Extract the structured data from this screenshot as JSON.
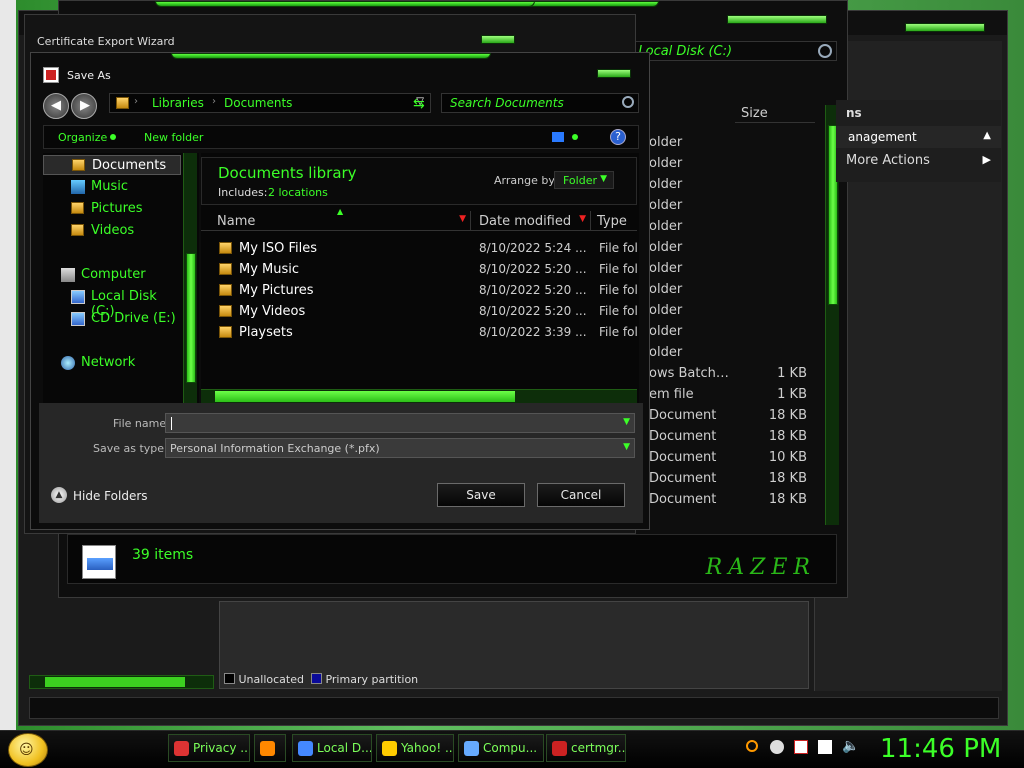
{
  "certmgr": {
    "title": "Certificate Export Wizard"
  },
  "explorer_bg": {
    "address": "h Local Disk (C:)",
    "col_size": "Size",
    "right_panel_title": "ns",
    "right_items": [
      "anagement",
      "More Actions"
    ],
    "rows": [
      {
        "type": "older",
        "size": ""
      },
      {
        "type": "older",
        "size": ""
      },
      {
        "type": "older",
        "size": ""
      },
      {
        "type": "older",
        "size": ""
      },
      {
        "type": "older",
        "size": ""
      },
      {
        "type": "older",
        "size": ""
      },
      {
        "type": "older",
        "size": ""
      },
      {
        "type": "older",
        "size": ""
      },
      {
        "type": "older",
        "size": ""
      },
      {
        "type": "older",
        "size": ""
      },
      {
        "type": "older",
        "size": ""
      },
      {
        "type": "ows Batch…",
        "size": "1 KB"
      },
      {
        "type": "em file",
        "size": "1 KB"
      },
      {
        "type": "Document",
        "size": "18 KB"
      },
      {
        "type": "Document",
        "size": "18 KB"
      },
      {
        "type": "Document",
        "size": "10 KB"
      },
      {
        "type": "Document",
        "size": "18 KB"
      },
      {
        "type": "Document",
        "size": "18 KB"
      }
    ],
    "status_count": "39 items",
    "logo_text": "RAZER"
  },
  "diskmgmt": {
    "legend": [
      "Unallocated",
      "Primary partition"
    ]
  },
  "dialog": {
    "title": "Save As",
    "breadcrumb": [
      "Libraries",
      "Documents"
    ],
    "search_placeholder": "Search Documents",
    "toolbar": {
      "organize": "Organize",
      "new_folder": "New folder"
    },
    "nav": {
      "favorites": [
        {
          "label": "Documents",
          "selected": true
        },
        {
          "label": "Music"
        },
        {
          "label": "Pictures"
        },
        {
          "label": "Videos"
        }
      ],
      "computer": "Computer",
      "drives": [
        "Local Disk (C:)",
        "CD Drive (E:)"
      ],
      "network": "Network"
    },
    "library": {
      "title": "Documents library",
      "includes_label": "Includes:",
      "includes_value": "2 locations",
      "arrange_label": "Arrange by:",
      "arrange_value": "Folder"
    },
    "columns": [
      "Name",
      "Date modified",
      "Type"
    ],
    "files": [
      {
        "name": "My ISO Files",
        "date": "8/10/2022 5:24 ...",
        "type": "File folc"
      },
      {
        "name": "My Music",
        "date": "8/10/2022 5:20 ...",
        "type": "File folc"
      },
      {
        "name": "My Pictures",
        "date": "8/10/2022 5:20 ...",
        "type": "File folc"
      },
      {
        "name": "My Videos",
        "date": "8/10/2022 5:20 ...",
        "type": "File folc"
      },
      {
        "name": "Playsets",
        "date": "8/10/2022 3:39 ...",
        "type": "File folc"
      }
    ],
    "file_name_label": "File name:",
    "file_name_value": "",
    "save_type_label": "Save as type:",
    "save_type_value": "Personal Information Exchange (*.pfx)",
    "hide_folders": "Hide Folders",
    "save_button": "Save",
    "cancel_button": "Cancel"
  },
  "taskbar": {
    "items": [
      {
        "label": "Privacy ...",
        "icon": "chrome-icon"
      },
      {
        "label": "",
        "icon": "firefox-icon"
      },
      {
        "label": "Local D...",
        "icon": "drive-icon"
      },
      {
        "label": "Yahoo! ...",
        "icon": "yahoo-icon"
      },
      {
        "label": "Compu...",
        "icon": "computer-icon"
      },
      {
        "label": "certmgr...",
        "icon": "certmgr-icon"
      }
    ],
    "clock": "11:46 PM"
  },
  "colors": {
    "accent": "#3cff28",
    "bg": "#111111"
  }
}
